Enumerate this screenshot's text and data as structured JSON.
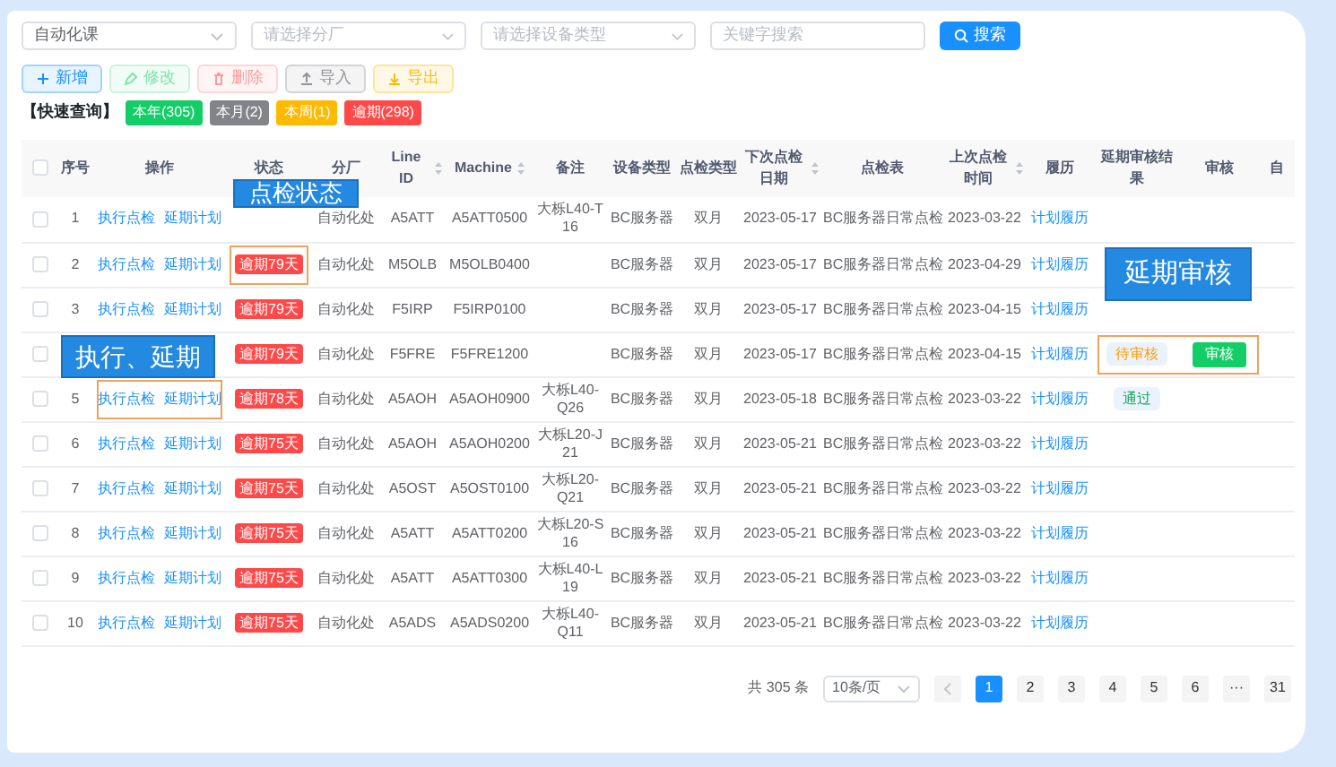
{
  "filters": [
    {
      "kind": "select",
      "value": "自动化课"
    },
    {
      "kind": "select",
      "placeholder": "请选择分厂"
    },
    {
      "kind": "select",
      "placeholder": "请选择设备类型"
    },
    {
      "kind": "input",
      "placeholder": "关键字搜索"
    }
  ],
  "search_button": "搜索",
  "toolbar": [
    {
      "label": "新增",
      "kind": "add",
      "disabled": false
    },
    {
      "label": "修改",
      "kind": "edit",
      "disabled": true
    },
    {
      "label": "删除",
      "kind": "delete",
      "disabled": true
    },
    {
      "label": "导入",
      "kind": "import",
      "disabled": false
    },
    {
      "label": "导出",
      "kind": "export",
      "disabled": false
    }
  ],
  "quick_query": {
    "label": "【快速查询】",
    "tags": [
      {
        "label": "本年(305)",
        "color": "#13ce66"
      },
      {
        "label": "本月(2)",
        "color": "#82848a"
      },
      {
        "label": "本周(1)",
        "color": "#ffba00"
      },
      {
        "label": "逾期(298)",
        "color": "#ff4949"
      }
    ]
  },
  "table": {
    "header_checked": false,
    "columns": [
      {
        "label": "序号",
        "sortable": false
      },
      {
        "label": "操作",
        "sortable": false
      },
      {
        "label": "状态",
        "sortable": false
      },
      {
        "label": "分厂",
        "sortable": false
      },
      {
        "label": "Line ID",
        "sortable": true
      },
      {
        "label": "Machine",
        "sortable": true
      },
      {
        "label": "备注",
        "sortable": false
      },
      {
        "label": "设备类型",
        "sortable": false
      },
      {
        "label": "点检类型",
        "sortable": false
      },
      {
        "label": "下次点检日期",
        "sortable": true
      },
      {
        "label": "点检表",
        "sortable": false
      },
      {
        "label": "上次点检时间",
        "sortable": true
      },
      {
        "label": "履历",
        "sortable": false
      },
      {
        "label": "延期审核结果",
        "sortable": false
      },
      {
        "label": "审核",
        "sortable": false
      },
      {
        "label": "自",
        "sortable": false
      }
    ],
    "rows": [
      {
        "checked": false,
        "seq": "1",
        "actions": [
          "执行点检",
          "延期计划"
        ],
        "plant": "自动化处",
        "line": "A5ATT",
        "machine": "A5ATT0500",
        "remark": "大栎L40-T16",
        "type": "BC服务器",
        "cycle": "双月",
        "next": "2023-05-17",
        "sheet": "BC服务器日常点检",
        "last": "2023-03-22",
        "history": "计划履历"
      },
      {
        "checked": false,
        "seq": "2",
        "actions": [
          "执行点检",
          "延期计划"
        ],
        "status": "逾期79天",
        "status_framed": true,
        "plant": "自动化处",
        "line": "M5OLB",
        "machine": "M5OLB0400",
        "type": "BC服务器",
        "cycle": "双月",
        "next": "2023-05-17",
        "sheet": "BC服务器日常点检",
        "last": "2023-04-29",
        "history": "计划履历"
      },
      {
        "checked": false,
        "seq": "3",
        "actions": [
          "执行点检",
          "延期计划"
        ],
        "status": "逾期79天",
        "plant": "自动化处",
        "line": "F5IRP",
        "machine": "F5IRP0100",
        "type": "BC服务器",
        "cycle": "双月",
        "next": "2023-05-17",
        "sheet": "BC服务器日常点检",
        "last": "2023-04-15",
        "history": "计划履历"
      },
      {
        "checked": false,
        "status": "逾期79天",
        "plant": "自动化处",
        "line": "F5FRE",
        "machine": "F5FRE1200",
        "type": "BC服务器",
        "cycle": "双月",
        "next": "2023-05-17",
        "sheet": "BC服务器日常点检",
        "last": "2023-04-15",
        "history": "计划履历",
        "review_result": {
          "label": "待审核",
          "kind": "pending"
        },
        "review_button": "审核",
        "review_framed": true
      },
      {
        "checked": false,
        "seq": "5",
        "actions": [
          "执行点检",
          "延期计划"
        ],
        "actions_framed": true,
        "status": "逾期78天",
        "plant": "自动化处",
        "line": "A5AOH",
        "machine": "A5AOH0900",
        "remark": "大栎L40-Q26",
        "type": "BC服务器",
        "cycle": "双月",
        "next": "2023-05-18",
        "sheet": "BC服务器日常点检",
        "last": "2023-03-22",
        "history": "计划履历",
        "review_result": {
          "label": "通过",
          "kind": "passed"
        }
      },
      {
        "checked": false,
        "seq": "6",
        "actions": [
          "执行点检",
          "延期计划"
        ],
        "status": "逾期75天",
        "plant": "自动化处",
        "line": "A5AOH",
        "machine": "A5AOH0200",
        "remark": "大栎L20-J21",
        "type": "BC服务器",
        "cycle": "双月",
        "next": "2023-05-21",
        "sheet": "BC服务器日常点检",
        "last": "2023-03-22",
        "history": "计划履历"
      },
      {
        "checked": false,
        "seq": "7",
        "actions": [
          "执行点检",
          "延期计划"
        ],
        "status": "逾期75天",
        "plant": "自动化处",
        "line": "A5OST",
        "machine": "A5OST0100",
        "remark": "大栎L20-Q21",
        "type": "BC服务器",
        "cycle": "双月",
        "next": "2023-05-21",
        "sheet": "BC服务器日常点检",
        "last": "2023-03-22",
        "history": "计划履历"
      },
      {
        "checked": false,
        "seq": "8",
        "actions": [
          "执行点检",
          "延期计划"
        ],
        "status": "逾期75天",
        "plant": "自动化处",
        "line": "A5ATT",
        "machine": "A5ATT0200",
        "remark": "大栎L20-S16",
        "type": "BC服务器",
        "cycle": "双月",
        "next": "2023-05-21",
        "sheet": "BC服务器日常点检",
        "last": "2023-03-22",
        "history": "计划履历"
      },
      {
        "checked": false,
        "seq": "9",
        "actions": [
          "执行点检",
          "延期计划"
        ],
        "status": "逾期75天",
        "plant": "自动化处",
        "line": "A5ATT",
        "machine": "A5ATT0300",
        "remark": "大栎L40-L19",
        "type": "BC服务器",
        "cycle": "双月",
        "next": "2023-05-21",
        "sheet": "BC服务器日常点检",
        "last": "2023-03-22",
        "history": "计划履历"
      },
      {
        "checked": false,
        "seq": "10",
        "actions": [
          "执行点检",
          "延期计划"
        ],
        "status": "逾期75天",
        "plant": "自动化处",
        "line": "A5ADS",
        "machine": "A5ADS0200",
        "remark": "大栎L40-Q11",
        "type": "BC服务器",
        "cycle": "双月",
        "next": "2023-05-21",
        "sheet": "BC服务器日常点检",
        "last": "2023-03-22",
        "history": "计划履历"
      }
    ]
  },
  "annotations": [
    {
      "text": "点检状态"
    },
    {
      "text": "延期审核"
    },
    {
      "text": "执行、延期"
    }
  ],
  "pagination": {
    "total": "共 305 条",
    "page_size": "10条/页",
    "pages": [
      {
        "label": "1",
        "selected": true
      },
      {
        "label": "2",
        "selected": false
      },
      {
        "label": "3",
        "selected": false
      },
      {
        "label": "4",
        "selected": false
      },
      {
        "label": "5",
        "selected": false
      },
      {
        "label": "6",
        "selected": false
      },
      {
        "label": "···",
        "selected": false
      },
      {
        "label": "31",
        "selected": false
      }
    ]
  }
}
